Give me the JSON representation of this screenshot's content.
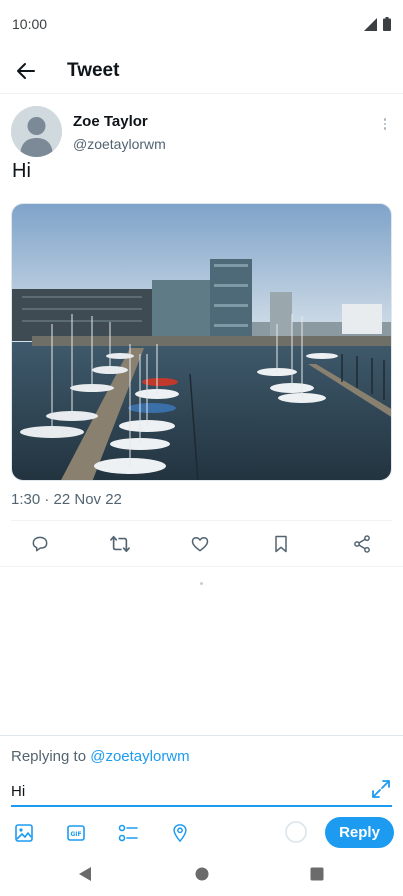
{
  "status_bar": {
    "time": "10:00"
  },
  "header": {
    "title": "Tweet"
  },
  "tweet": {
    "author_name": "Zoe Taylor",
    "author_handle": "@zoetaylorwm",
    "text": "Hi",
    "timestamp": "1:30 · 22 Nov 22",
    "media_description": "harbour-with-sailboats-photo"
  },
  "actions": [
    "reply-icon",
    "retweet-icon",
    "like-icon",
    "bookmark-icon",
    "share-icon"
  ],
  "reply": {
    "replying_prefix": "Replying to",
    "replying_handle": "@zoetaylorwm",
    "input_value": "Hi",
    "button_label": "Reply"
  },
  "toolbar": [
    "image-icon",
    "gif-icon",
    "poll-icon",
    "location-icon"
  ],
  "colors": {
    "accent": "#1d9bf0",
    "text_primary": "#0f1419",
    "text_secondary": "#536471",
    "divider": "#eff3f4"
  }
}
